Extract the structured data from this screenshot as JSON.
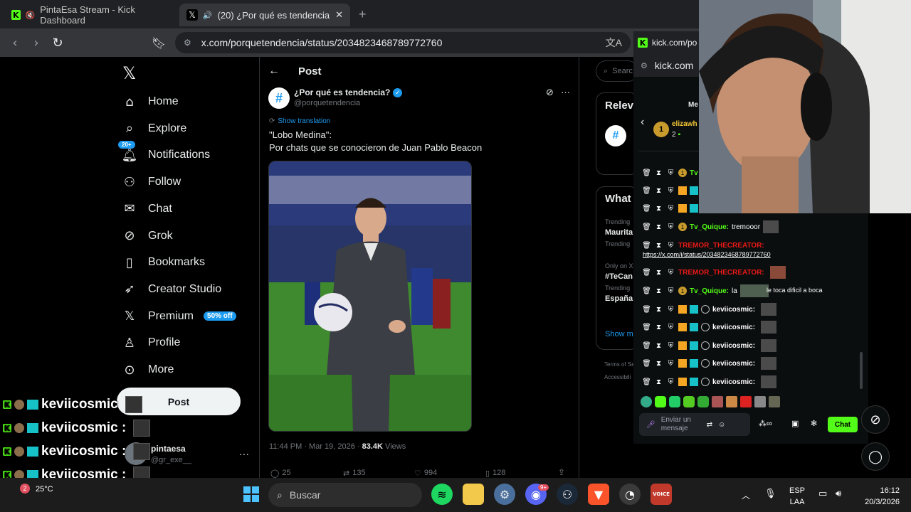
{
  "browser": {
    "tabs": [
      {
        "title": "PintaEsa Stream - Kick Dashboard"
      },
      {
        "title": "(20) ¿Por qué es tendencia? o"
      }
    ],
    "url": "x.com/porquetendencia/status/2034823468789772760",
    "popup_url": "kick.com/po",
    "popup_url2": "kick.com"
  },
  "sidebar": {
    "items": [
      {
        "label": "Home",
        "icon": "home-icon"
      },
      {
        "label": "Explore",
        "icon": "search-icon"
      },
      {
        "label": "Notifications",
        "icon": "bell-icon",
        "badge": "20+"
      },
      {
        "label": "Follow",
        "icon": "follow-icon"
      },
      {
        "label": "Chat",
        "icon": "mail-icon"
      },
      {
        "label": "Grok",
        "icon": "grok-icon"
      },
      {
        "label": "Bookmarks",
        "icon": "bookmark-icon"
      },
      {
        "label": "Creator Studio",
        "icon": "rocket-icon"
      },
      {
        "label": "Premium",
        "icon": "x-icon",
        "badge": "50% off"
      },
      {
        "label": "Profile",
        "icon": "person-icon"
      },
      {
        "label": "More",
        "icon": "more-icon"
      }
    ],
    "post_button": "Post",
    "account": {
      "name": "pintaesa",
      "handle": "@gr_exe__"
    }
  },
  "post": {
    "header": "Post",
    "author": "¿Por qué es tendencia?",
    "handle": "@porquetendencia",
    "show_translation": "Show translation",
    "text_line1": "\"Lobo Medina\":",
    "text_line2": "Por chats que se conocieron de Juan Pablo Beacon",
    "timestamp": "11:44 PM · Mar 19, 2026 · ",
    "views": "83.4K",
    "views_label": " Views",
    "replies": "25",
    "reposts": "135",
    "likes": "994",
    "bookmarks": "128"
  },
  "right": {
    "search": "Searc",
    "relevant": "Relev",
    "whats": "What",
    "trends": [
      {
        "label": "Trending",
        "name": "Maurita"
      },
      {
        "label": "Trending",
        "name": ""
      },
      {
        "label": "Only on X",
        "name": "#TeCan"
      },
      {
        "label": "Trending",
        "name": "España"
      }
    ],
    "show_more": "Show m",
    "terms": "Terms of Se",
    "access": "Accessibili"
  },
  "chat": {
    "header_user": "elizawh",
    "header_count": "2",
    "header_me": "Me",
    "messages": [
      {
        "user": "Tv",
        "cls": "green",
        "text": ""
      },
      {
        "user": "",
        "cls": "white",
        "text": ""
      },
      {
        "user": "",
        "cls": "white",
        "text": ""
      },
      {
        "user": "Tv_Quique:",
        "cls": "green",
        "text": "tremooor"
      },
      {
        "user": "TREMOR_THECREATOR:",
        "cls": "red",
        "text": ""
      },
      {
        "user": "TREMOR_THECREATOR:",
        "cls": "red",
        "text": ""
      },
      {
        "user": "Tv_Quique:",
        "cls": "green",
        "text": "la"
      },
      {
        "user": "keviicosmic:",
        "cls": "white",
        "text": ""
      },
      {
        "user": "keviicosmic:",
        "cls": "white",
        "text": ""
      },
      {
        "user": "keviicosmic:",
        "cls": "white",
        "text": ""
      },
      {
        "user": "keviicosmic:",
        "cls": "white",
        "text": ""
      },
      {
        "user": "keviicosmic:",
        "cls": "white",
        "text": ""
      }
    ],
    "link": "https://x.com/i/status/2034823468789772760",
    "la_suffix": "le toca dificil a boca",
    "input_placeholder": "Enviar un mensaje",
    "send": "Chat"
  },
  "overlay": {
    "rows": [
      "keviicosmic",
      "keviicosmic :",
      "keviicosmic :",
      "keviicosmic :",
      "keviicosmic :"
    ]
  },
  "taskbar": {
    "weather_temp": "25°C",
    "weather_badge": "2",
    "search": "Buscar",
    "lang1": "ESP",
    "lang2": "LAA",
    "time": "16:12",
    "date": "20/3/2026",
    "discord_badge": "9+"
  },
  "colors": {
    "kick_green": "#53fc18",
    "x_blue": "#1d9bf0"
  }
}
